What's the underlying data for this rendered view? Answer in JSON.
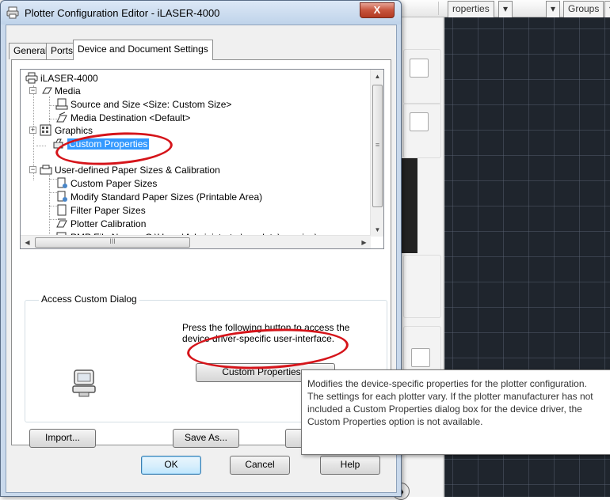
{
  "background": {
    "ribbon_tabs": [
      "roperties",
      "Groups"
    ],
    "dropdown_glyph": "▾"
  },
  "dialog": {
    "title": "Plotter Configuration Editor - iLASER-4000",
    "close_glyph": "X",
    "tabs": [
      "General",
      "Ports",
      "Device and Document Settings"
    ],
    "tree": {
      "root": "iLASER-4000",
      "media": "Media",
      "source_size": "Source and Size <Size: Custom Size>",
      "media_destination": "Media Destination <Default>",
      "graphics": "Graphics",
      "custom_properties": "Custom Properties",
      "user_defined": "User-defined Paper Sizes & Calibration",
      "custom_paper_sizes": "Custom Paper Sizes",
      "modify_standard": "Modify Standard Paper Sizes (Printable Area)",
      "filter_paper_sizes": "Filter Paper Sizes",
      "plotter_calibration": "Plotter Calibration",
      "pmp_file": "PMP File Name <C:\\Users\\Administrator\\appdata\\roaming\\"
    },
    "scroll_thumb_grip": "III",
    "group_title": "Access Custom Dialog",
    "description": "Press the following button to access the device driver-specific user-interface.",
    "custom_properties_button": "Custom Properties...",
    "import_button": "Import...",
    "save_as_button": "Save As...",
    "ok_button": "OK",
    "cancel_button": "Cancel",
    "help_button": "Help"
  },
  "tooltip": {
    "text": "Modifies the device-specific properties for the plotter configuration. The settings for each plotter vary. If the plotter manufacturer has not included a Custom Properties dialog box for the device driver, the Custom Properties option is not available."
  },
  "colors": {
    "selection": "#3399ff",
    "annotation": "#d5141a",
    "canvas": "#1f252d"
  }
}
